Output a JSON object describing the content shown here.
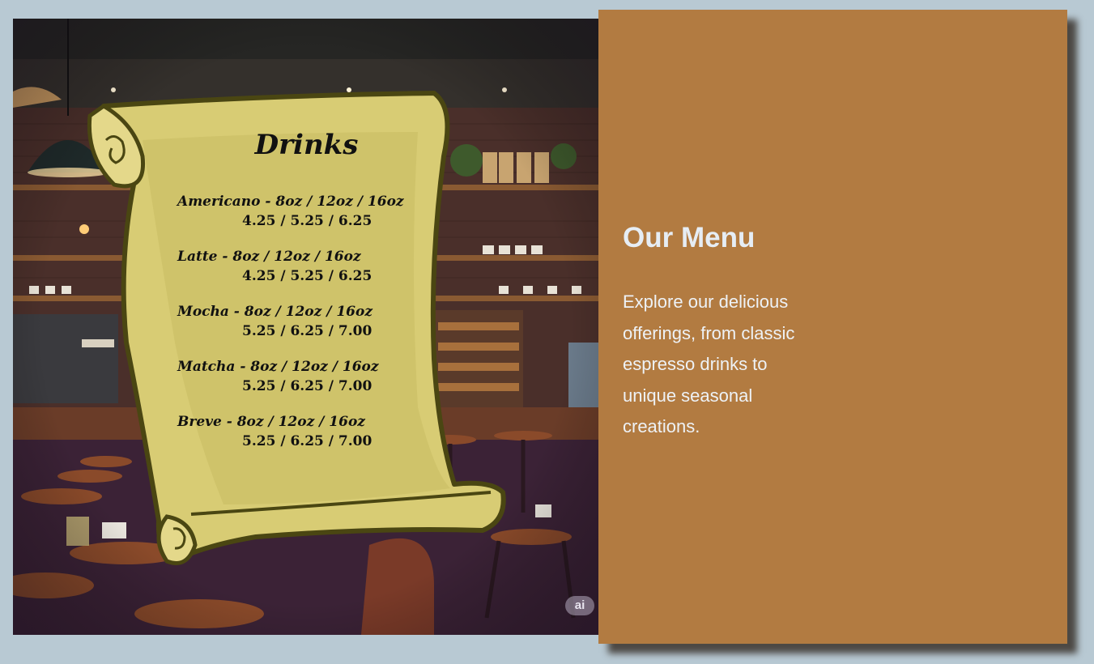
{
  "menu_image": {
    "title": "Drinks",
    "items": [
      {
        "name_sizes": "Americano - 8oz / 12oz / 16oz",
        "prices": "4.25 / 5.25 / 6.25"
      },
      {
        "name_sizes": "Latte - 8oz / 12oz / 16oz",
        "prices": "4.25 / 5.25 / 6.25"
      },
      {
        "name_sizes": "Mocha - 8oz / 12oz / 16oz",
        "prices": "5.25 / 6.25 / 7.00"
      },
      {
        "name_sizes": "Matcha - 8oz / 12oz / 16oz",
        "prices": "5.25 / 6.25 / 7.00"
      },
      {
        "name_sizes": "Breve - 8oz / 12oz / 16oz",
        "prices": "5.25 / 6.25 / 7.00"
      }
    ],
    "badge": "ai"
  },
  "card": {
    "title": "Our Menu",
    "description": "Explore our delicious offerings, from classic espresso drinks to unique seasonal creations."
  },
  "colors": {
    "page_background": "#b8c9d3",
    "card_background": "#b27b41",
    "card_text": "#eef2f6",
    "scroll_parchment": "#d8cc74",
    "scroll_outline": "#4a4612"
  }
}
